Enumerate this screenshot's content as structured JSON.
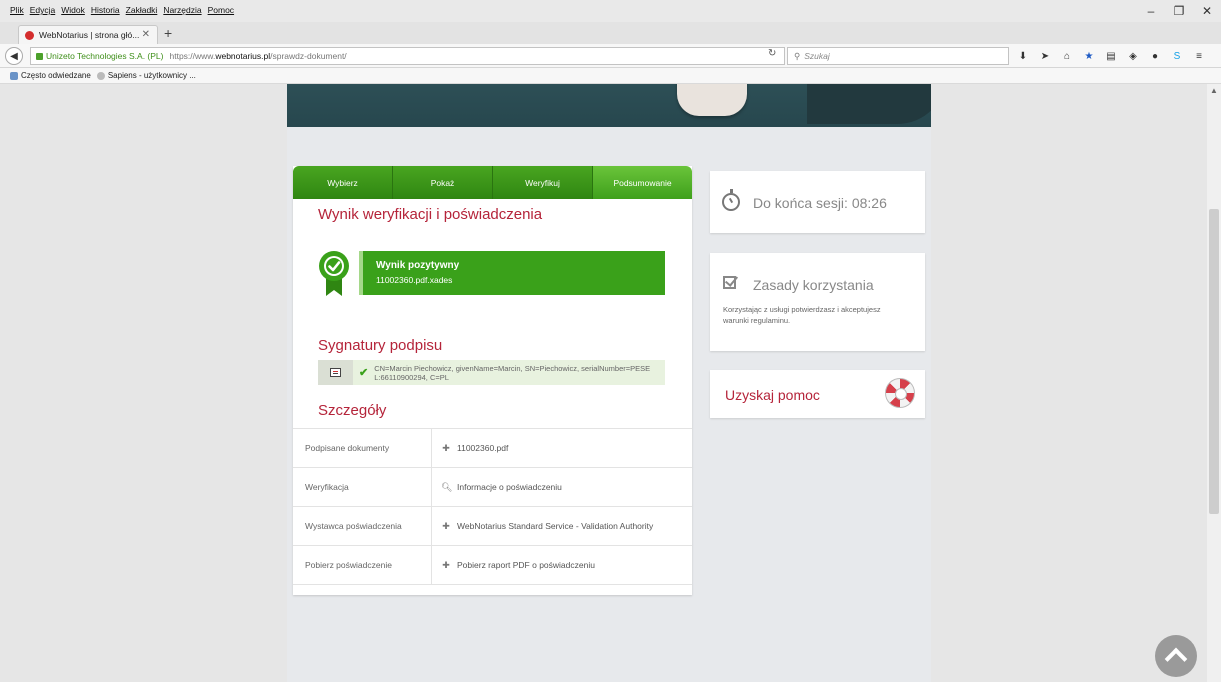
{
  "menu": [
    "Plik",
    "Edycja",
    "Widok",
    "Historia",
    "Zakładki",
    "Narzędzia",
    "Pomoc"
  ],
  "window_controls": {
    "minimize": "–",
    "maximize": "❐",
    "close": "✕"
  },
  "tab": {
    "title": "WebNotarius | strona głó...",
    "close": "✕",
    "new": "+"
  },
  "address": {
    "org": "Unizeto Technologies S.A. (PL)",
    "url_prefix": "https://www.",
    "url_domain": "webnotarius.pl",
    "url_path": "/sprawdz-dokument/"
  },
  "search": {
    "placeholder": "Szukaj"
  },
  "bookmarks": [
    {
      "label": "Często odwiedzane",
      "icon": "folder-icon"
    },
    {
      "label": "Sapiens - użytkownicy ...",
      "icon": "globe-icon"
    }
  ],
  "steps": [
    "Wybierz",
    "Pokaż",
    "Weryfikuj",
    "Podsumowanie"
  ],
  "result": {
    "heading": "Wynik weryfikacji i poświadczenia",
    "status": "Wynik pozytywny",
    "file": "11002360.pdf.xades",
    "color": "#3aa11a"
  },
  "signatures": {
    "heading": "Sygnatury podpisu",
    "entry": "CN=Marcin Piechowicz, givenName=Marcin, SN=Piechowicz, serialNumber=PESEL:66110900294, C=PL"
  },
  "details": {
    "heading": "Szczegóły",
    "rows": [
      {
        "label": "Podpisane dokumenty",
        "value": "11002360.pdf",
        "icon": "download-icon"
      },
      {
        "label": "Weryfikacja",
        "value": "Informacje o poświadczeniu",
        "icon": "search-icon"
      },
      {
        "label": "Wystawca poświadczenia",
        "value": "WebNotarius Standard Service - Validation Authority",
        "icon": "download-icon"
      },
      {
        "label": "Pobierz poświadczenie",
        "value": "Pobierz raport PDF o poświadczeniu",
        "icon": "download-icon"
      }
    ]
  },
  "session": {
    "label": "Do końca sesji: 08:26"
  },
  "rules": {
    "title": "Zasady korzystania",
    "desc": "Korzystając z usługi potwierdzasz i akceptujesz warunki regulaminu."
  },
  "help": {
    "title": "Uzyskaj pomoc"
  },
  "colors": {
    "accent_red": "#b5243a",
    "brand_green": "#3aa11a"
  }
}
